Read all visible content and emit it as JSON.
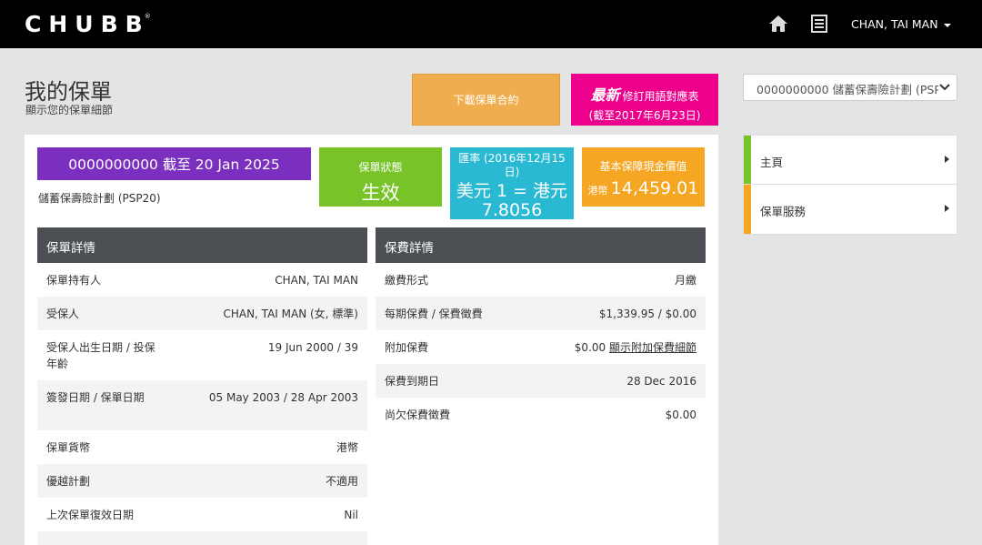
{
  "header": {
    "logo": "CHUBB",
    "logo_mark": "®",
    "user_name": "CHAN, TAI MAN"
  },
  "page": {
    "title": "我的保單",
    "subtitle": "顯示您的保單細節"
  },
  "actions": {
    "download_label": "下載保單合約",
    "latest_bold": "最新",
    "latest_line1": "修訂用語對應表",
    "latest_line2": "(截至2017年6月23日)"
  },
  "plan_selector": {
    "selected": "0000000000 儲蓄保壽險計劃 (PSP"
  },
  "sidenav": {
    "items": [
      {
        "label": "主頁",
        "color": "#78c428"
      },
      {
        "label": "保單服務",
        "color": "#f5a623"
      }
    ]
  },
  "policy": {
    "banner": "0000000000 截至 20 Jan 2025",
    "banner_color": "#7b2fbe",
    "plan_name": "儲蓄保壽險計劃 (PSP20)"
  },
  "tiles": {
    "status": {
      "label": "保單狀態",
      "value": "生效",
      "color": "#78c428"
    },
    "rate": {
      "label": "匯率 (2016年12月15日)",
      "value": "美元 1 = 港元 7.8056",
      "color": "#29b9d3"
    },
    "cash": {
      "label": "基本保障現金價值",
      "currency": "港幣",
      "value": "14,459.01",
      "color": "#f5a623"
    }
  },
  "policy_details": {
    "heading": "保單詳情",
    "rows": [
      {
        "key": "保單持有人",
        "value": "CHAN, TAI MAN"
      },
      {
        "key": "受保人",
        "value": "CHAN, TAI MAN (女, 標準)"
      },
      {
        "key": "受保人出生日期 / 投保年齡",
        "value": "19 Jun 2000 / 39"
      },
      {
        "key": "簽發日期 / 保單日期",
        "value": "05 May 2003 / 28 Apr 2003"
      },
      {
        "key": "保單貨幣",
        "value": "港幣"
      },
      {
        "key": "優越計劃",
        "value": "不適用"
      },
      {
        "key": "上次保單復效日期",
        "value": "Nil"
      }
    ]
  },
  "premium_details": {
    "heading": "保費詳情",
    "rows": [
      {
        "key": "繳費形式",
        "value": "月繳"
      },
      {
        "key": "每期保費 / 保費徵費",
        "value": "$1,339.95 / $0.00"
      },
      {
        "key": "附加保費",
        "value": "$0.00",
        "link": "顯示附加保費細節"
      },
      {
        "key": "保費到期日",
        "value": "28 Dec 2016"
      },
      {
        "key": "尚欠保費徵費",
        "value": "$0.00"
      }
    ]
  }
}
